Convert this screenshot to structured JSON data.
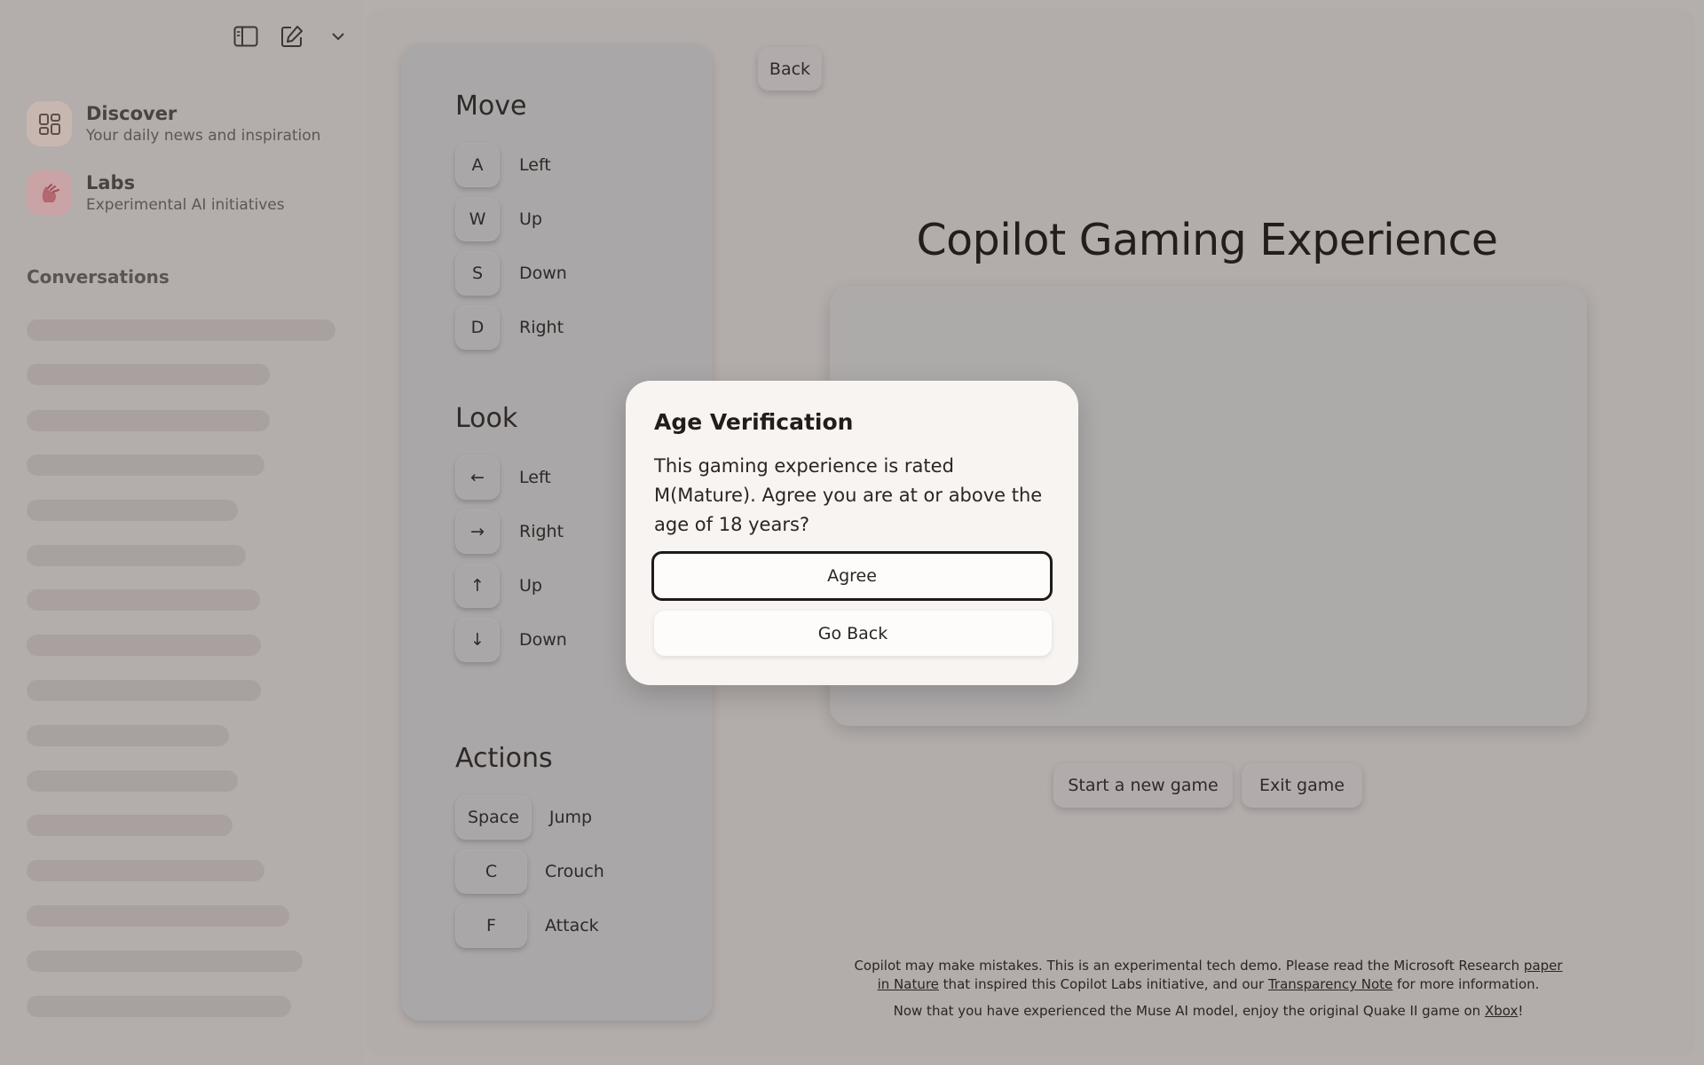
{
  "sidebar": {
    "items": [
      {
        "title": "Discover",
        "subtitle": "Your daily news and inspiration"
      },
      {
        "title": "Labs",
        "subtitle": "Experimental AI initiatives"
      }
    ],
    "conversations_title": "Conversations"
  },
  "controls": {
    "move": {
      "heading": "Move",
      "rows": [
        {
          "key": "A",
          "label": "Left"
        },
        {
          "key": "W",
          "label": "Up"
        },
        {
          "key": "S",
          "label": "Down"
        },
        {
          "key": "D",
          "label": "Right"
        }
      ]
    },
    "look": {
      "heading": "Look",
      "rows": [
        {
          "key": "←",
          "label": "Left"
        },
        {
          "key": "→",
          "label": "Right"
        },
        {
          "key": "↑",
          "label": "Up"
        },
        {
          "key": "↓",
          "label": "Down"
        }
      ]
    },
    "actions": {
      "heading": "Actions",
      "rows": [
        {
          "key": "Space",
          "label": "Jump"
        },
        {
          "key": "C",
          "label": "Crouch"
        },
        {
          "key": "F",
          "label": "Attack"
        }
      ]
    }
  },
  "main": {
    "back_label": "Back",
    "title": "Copilot Gaming Experience",
    "new_game_label": "Start a new game",
    "exit_label": "Exit game",
    "footer": {
      "line1_a": "Copilot may make mistakes. This is an experimental tech demo. Please read the Microsoft Research ",
      "line1_link": "paper in Nature",
      "line1_b": " that inspired this Copilot Labs initiative, and our ",
      "line1_link2": "Transparency Note",
      "line1_c": " for more information.",
      "line2_a": "Now that you have experienced the Muse AI model, enjoy the original Quake II game on ",
      "line2_link": "Xbox",
      "line2_b": "!"
    }
  },
  "modal": {
    "title": "Age Verification",
    "body": "This gaming experience is rated M(Mature). Agree you are at or above the age of 18 years?",
    "agree_label": "Agree",
    "goback_label": "Go Back"
  },
  "colors": {
    "discover_tile": "#d6c3bb",
    "labs_tile": "#d9a6aa",
    "modal_bg": "#f7f4f1"
  }
}
